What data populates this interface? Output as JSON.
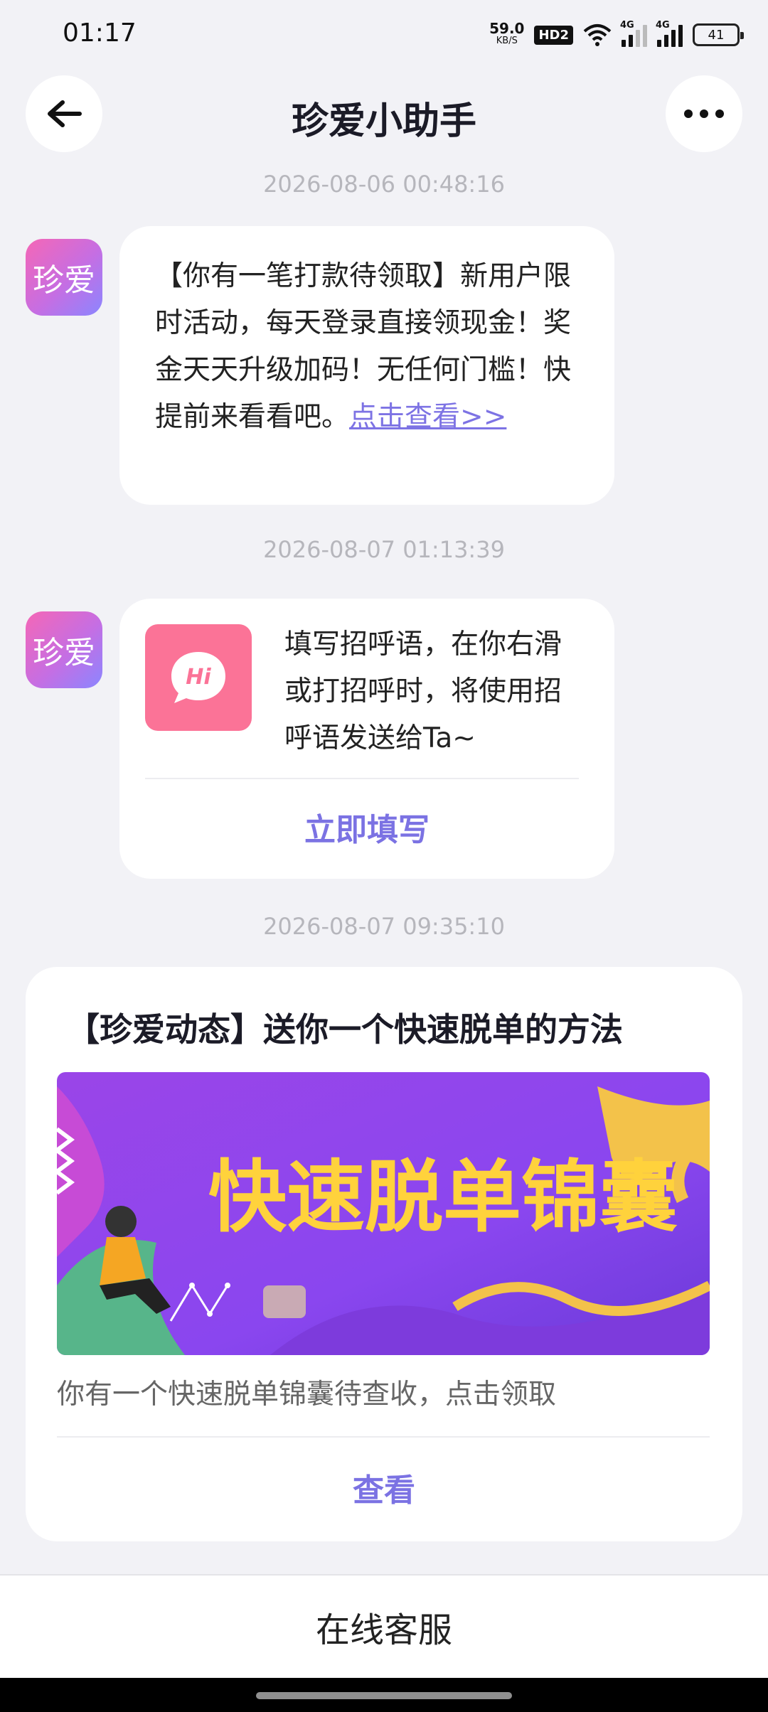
{
  "status_bar": {
    "time": "01:17",
    "net_speed": "59.0",
    "net_unit": "KB/S",
    "hd": "HD2",
    "signal1_label": "4G",
    "signal2_label": "4G",
    "battery": "41"
  },
  "header": {
    "title": "珍爱小助手",
    "back_icon": "arrow-left-icon",
    "more_icon": "more-dots-icon"
  },
  "messages": [
    {
      "timestamp": "2026-08-06 00:48:16",
      "avatar_text": "珍爱",
      "text": "【你有一笔打款待领取】新用户限时活动，每天登录直接领现金！奖金天天升级加码！无任何门槛！快提前来看看吧。",
      "link": "点击查看>>"
    },
    {
      "timestamp": "2026-08-07 01:13:39",
      "avatar_text": "珍爱",
      "icon_text": "Hi",
      "text": "填写招呼语，在你右滑或打招呼时，将使用招呼语发送给Ta~",
      "action": "立即填写"
    },
    {
      "timestamp": "2026-08-07 09:35:10",
      "title": "【珍爱动态】送你一个快速脱单的方法",
      "banner_text": "快速脱单锦囊",
      "description": "你有一个快速脱单锦囊待查收，点击领取",
      "action": "查看"
    }
  ],
  "footer": {
    "label": "在线客服"
  },
  "colors": {
    "accent": "#7b72e3",
    "background": "#f2f2f6",
    "hi_icon": "#fb7397"
  }
}
